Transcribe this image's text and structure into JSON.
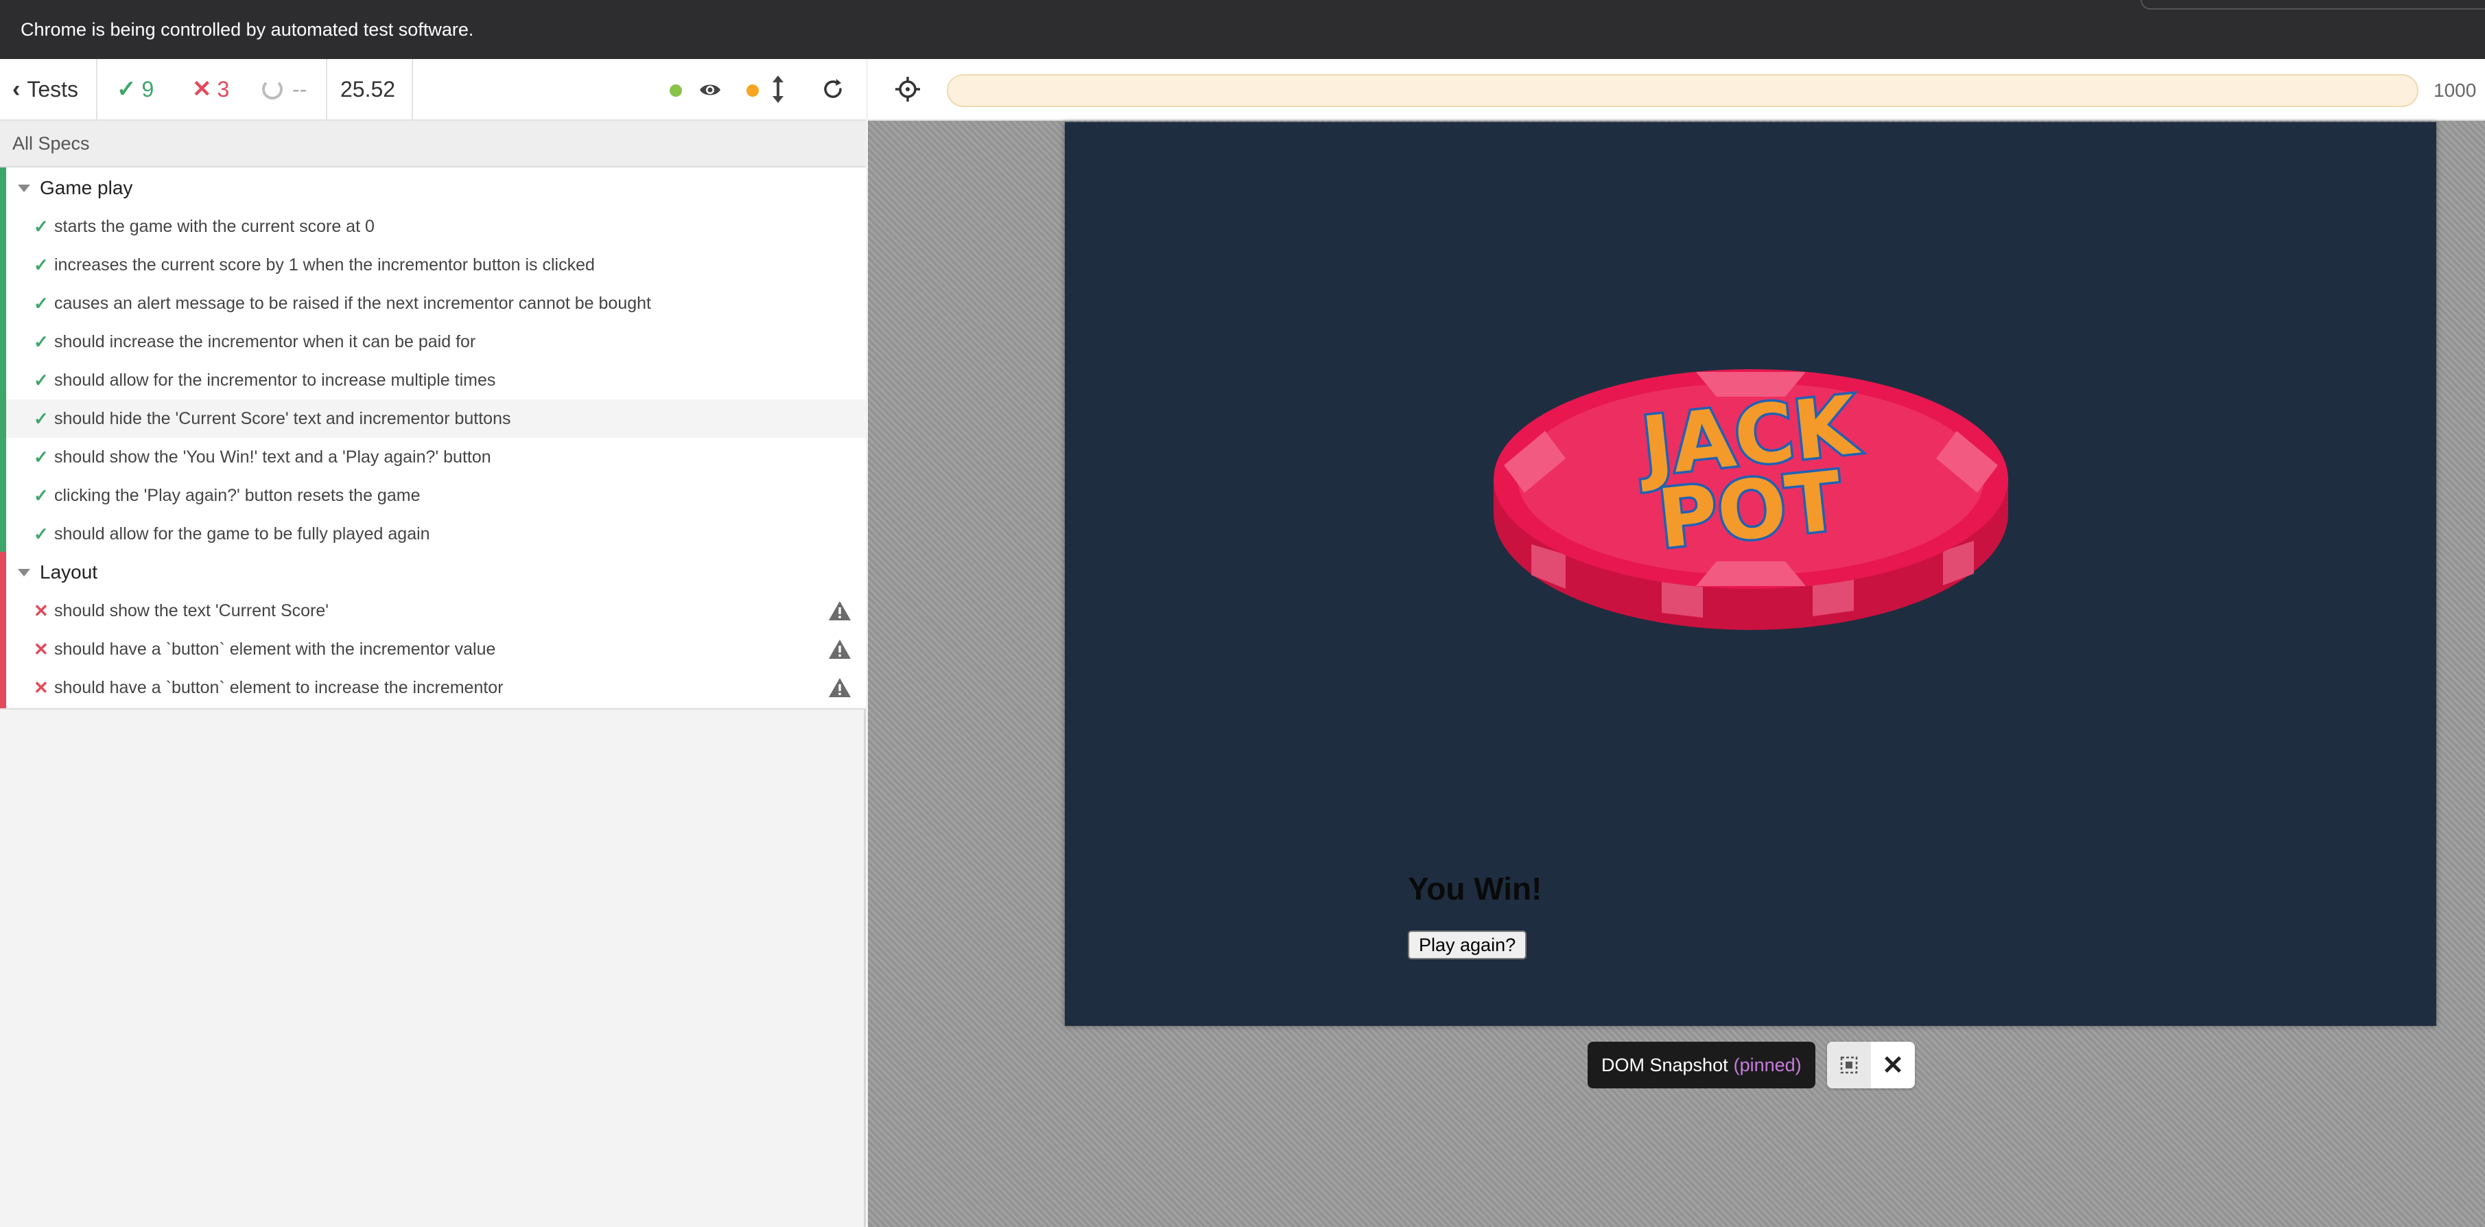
{
  "banner": {
    "text": "Chrome is being controlled by automated test software."
  },
  "reporter": {
    "tests_label": "Tests",
    "passed": "9",
    "failed": "3",
    "pending": "--",
    "duration": "25.52",
    "all_specs": "All Specs",
    "suites": [
      {
        "title": "Game play",
        "status": "passed",
        "tests": [
          {
            "title": "starts the game with the current score at 0",
            "status": "passed"
          },
          {
            "title": "increases the current score by 1 when the incrementor button is clicked",
            "status": "passed"
          },
          {
            "title": "causes an alert message to be raised if the next incrementor cannot be bought",
            "status": "passed"
          },
          {
            "title": "should increase the incrementor when it can be paid for",
            "status": "passed"
          },
          {
            "title": "should allow for the incrementor to increase multiple times",
            "status": "passed"
          },
          {
            "title": "should hide the 'Current Score' text and incrementor buttons",
            "status": "passed"
          },
          {
            "title": "should show the 'You Win!' text and a 'Play again?' button",
            "status": "passed"
          },
          {
            "title": "clicking the 'Play again?' button resets the game",
            "status": "passed"
          },
          {
            "title": "should allow for the game to be fully played again",
            "status": "passed"
          }
        ]
      },
      {
        "title": "Layout",
        "status": "failed",
        "tests": [
          {
            "title": "should show the text 'Current Score'",
            "status": "failed"
          },
          {
            "title": "should have a `button` element with the incrementor value",
            "status": "failed"
          },
          {
            "title": "should have a `button` element to increase the incrementor",
            "status": "failed"
          }
        ]
      }
    ]
  },
  "aut": {
    "viewport_width": "1000",
    "url": "",
    "app": {
      "logo_text": "JACK POT",
      "win_text": "You Win!",
      "play_again_label": "Play again?"
    },
    "snapshot": {
      "label": "DOM Snapshot",
      "pinned": "(pinned)"
    }
  },
  "colors": {
    "pass": "#3ea66a",
    "fail": "#e2495a",
    "app_bg": "#1f2d40",
    "chip_red": "#e8174f",
    "logo_orange": "#f39a2b",
    "logo_blue": "#1e62b5"
  }
}
